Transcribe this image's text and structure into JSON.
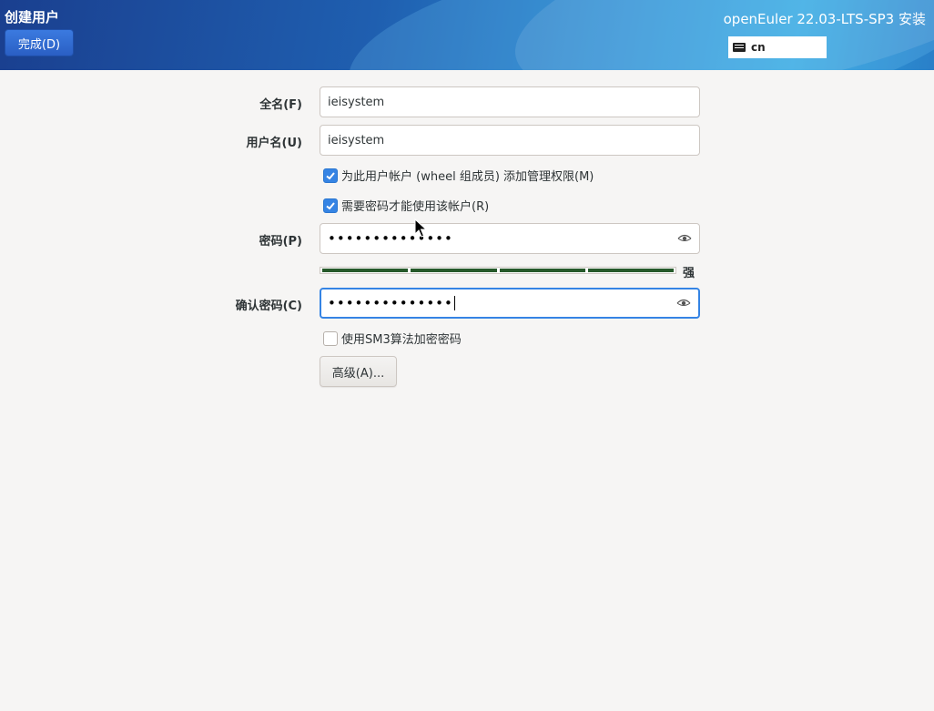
{
  "header": {
    "page_title": "创建用户",
    "done_button": "完成(D)",
    "product_title": "openEuler 22.03-LTS-SP3 安装",
    "keyboard_layout": "cn"
  },
  "form": {
    "fullname": {
      "label": "全名(F)",
      "value": "ieisystem"
    },
    "username": {
      "label": "用户名(U)",
      "value": "ieisystem"
    },
    "admin_checkbox": {
      "label": "为此用户帐户 (wheel 组成员) 添加管理权限(M)",
      "checked": true
    },
    "require_password_checkbox": {
      "label": "需要密码才能使用该帐户(R)",
      "checked": true
    },
    "password": {
      "label": "密码(P)",
      "masked_value": "••••••••••••••"
    },
    "strength": {
      "label": "强",
      "level_fraction": 1.0,
      "color": "#26592a"
    },
    "confirm_password": {
      "label": "确认密码(C)",
      "masked_value": "••••••••••••••"
    },
    "sm3_checkbox": {
      "label": "使用SM3算法加密密码",
      "checked": false
    },
    "advanced_button": "高级(A)..."
  },
  "colors": {
    "accent": "#3584e4",
    "done_button": "#2a5fc4"
  },
  "icons": {
    "keyboard": "keyboard-icon",
    "reveal_password": "eye-icon",
    "checkmark": "checkmark-icon"
  }
}
